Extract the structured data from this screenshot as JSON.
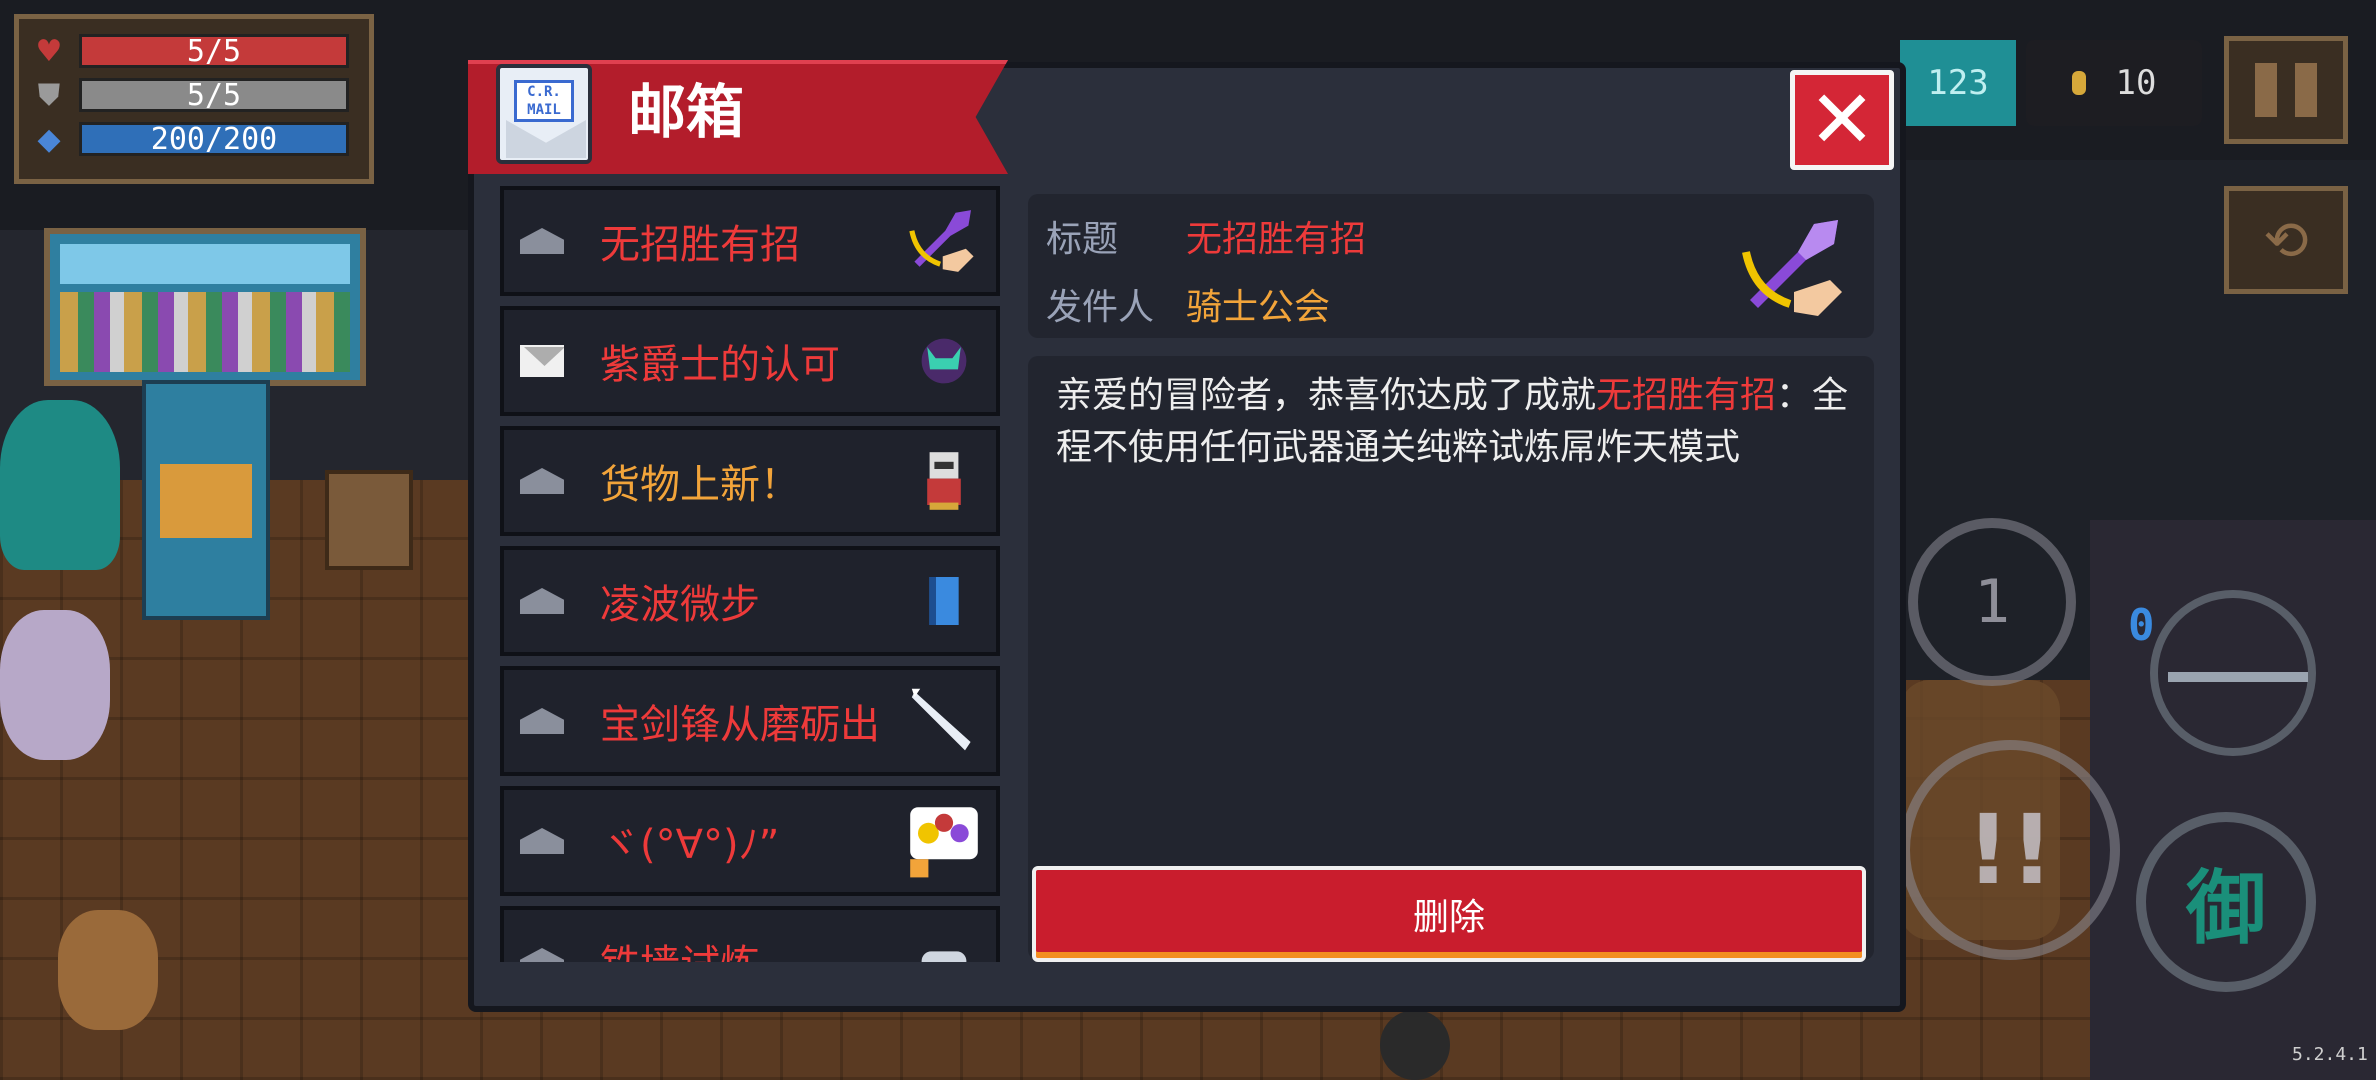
{
  "hud": {
    "hp": "5/5",
    "hp_fraction": 1.0,
    "armor": "5/5",
    "armor_fraction": 1.0,
    "energy": "200/200",
    "energy_fraction": 1.0,
    "gems": "123",
    "coins": "10",
    "skill_count": "1",
    "weapon_energy": "0",
    "version": "5.2.4.1",
    "defend_glyph": "御",
    "attack_glyph": "!!"
  },
  "modal": {
    "title": "邮箱",
    "mail_icon_text": "C.R. MAIL",
    "close_symbol": "✕"
  },
  "mail_list": [
    {
      "label": "无招胜有招",
      "color": "#ee3a3a",
      "status": "opened",
      "thumb_icon": "sword-hand-icon"
    },
    {
      "label": "紫爵士的认可",
      "color": "#ee3a3a",
      "status": "unread",
      "thumb_icon": "purple-knight-icon"
    },
    {
      "label": "货物上新！",
      "color": "#f2a43a",
      "status": "opened",
      "thumb_icon": "merchant-icon"
    },
    {
      "label": "凌波微步",
      "color": "#ee3a3a",
      "status": "opened",
      "thumb_icon": "blue-book-icon"
    },
    {
      "label": "宝剑锋从磨砺出",
      "color": "#ee3a3a",
      "status": "opened",
      "thumb_icon": "blade-icon"
    },
    {
      "label": "ヾ(°∀°)ﾉ”",
      "color": "#ee3a3a",
      "status": "opened",
      "thumb_icon": "emoji-icon"
    },
    {
      "label": "铁墙试炼",
      "color": "#ee3a3a",
      "status": "opened",
      "thumb_icon": "scroll-icon"
    }
  ],
  "detail": {
    "subject_label": "标题",
    "subject": "无招胜有招",
    "sender_label": "发件人",
    "sender": "骑士公会",
    "body_prefix": "亲爱的冒险者，恭喜你达成了成就",
    "body_highlight": "无招胜有招",
    "body_suffix": "：全程不使用任何武器通关纯粹试炼屌炸天模式",
    "delete_label": "删除"
  },
  "colors": {
    "accent_red": "#ee3a3a",
    "accent_orange": "#f2a43a",
    "title_tab": "#b31d2b",
    "panel": "#22252f"
  }
}
